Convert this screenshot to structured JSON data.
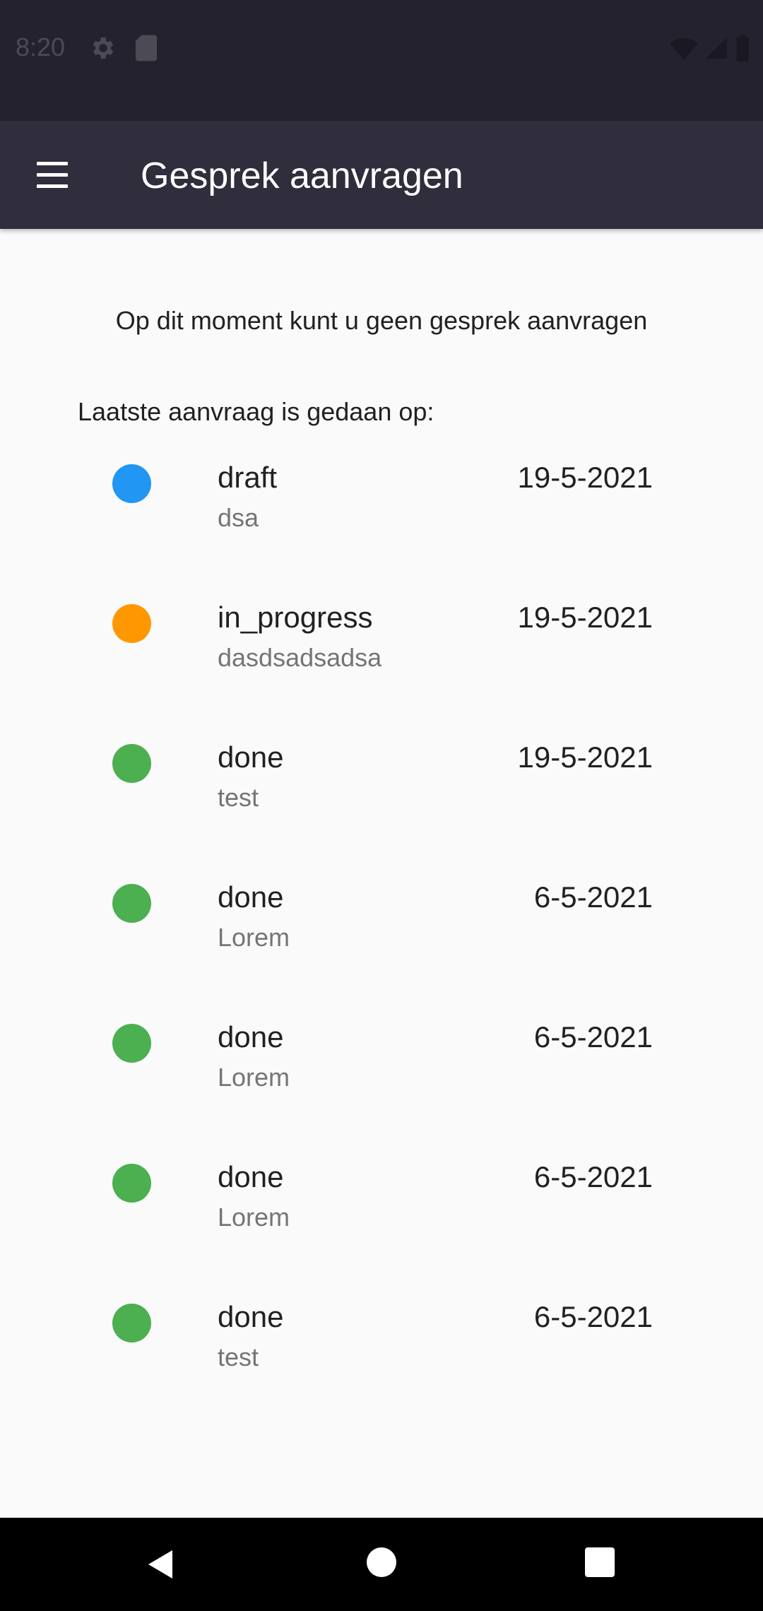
{
  "status_bar": {
    "time": "8:20",
    "icons": [
      "gear-icon",
      "sd-card-icon",
      "wifi-icon",
      "signal-icon",
      "battery-icon"
    ]
  },
  "app_bar": {
    "title": "Gesprek aanvragen",
    "menu_icon": "hamburger-menu-icon"
  },
  "main": {
    "notice": "Op dit moment kunt u geen gesprek aanvragen",
    "last_request_label": "Laatste aanvraag is gedaan op:",
    "items": [
      {
        "status": "draft",
        "subtitle": "dsa",
        "date": "19-5-2021",
        "color": "#2196f3"
      },
      {
        "status": "in_progress",
        "subtitle": "dasdsadsadsa",
        "date": "19-5-2021",
        "color": "#ff9800"
      },
      {
        "status": "done",
        "subtitle": "test",
        "date": "19-5-2021",
        "color": "#4caf50"
      },
      {
        "status": "done",
        "subtitle": "Lorem",
        "date": "6-5-2021",
        "color": "#4caf50"
      },
      {
        "status": "done",
        "subtitle": "Lorem",
        "date": "6-5-2021",
        "color": "#4caf50"
      },
      {
        "status": "done",
        "subtitle": "Lorem",
        "date": "6-5-2021",
        "color": "#4caf50"
      },
      {
        "status": "done",
        "subtitle": "test",
        "date": "6-5-2021",
        "color": "#4caf50"
      }
    ]
  },
  "nav_bar": {
    "icons": [
      "back-icon",
      "home-icon",
      "recents-icon"
    ]
  },
  "colors": {
    "status_bar": "#24222f",
    "app_bar": "#302d3d",
    "background": "#fafafa",
    "draft": "#2196f3",
    "in_progress": "#ff9800",
    "done": "#4caf50"
  }
}
